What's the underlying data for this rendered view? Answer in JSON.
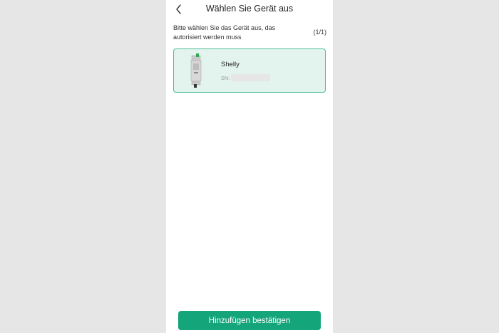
{
  "header": {
    "title": "Wählen Sie Gerät aus",
    "back_icon": "chevron-left-icon"
  },
  "instruction": {
    "text": "Bitte wählen Sie das Gerät aus, das autorisiert werden muss",
    "counter": "(1/1)"
  },
  "devices": [
    {
      "name": "Shelly",
      "sn_label": "SN:",
      "selected": true
    }
  ],
  "footer": {
    "confirm_label": "Hinzufügen bestätigen"
  },
  "colors": {
    "accent": "#15a57a",
    "selected_bg": "#e3f3ee",
    "selected_border": "#4cbf9a",
    "outer_bg": "#e6e6e6"
  }
}
